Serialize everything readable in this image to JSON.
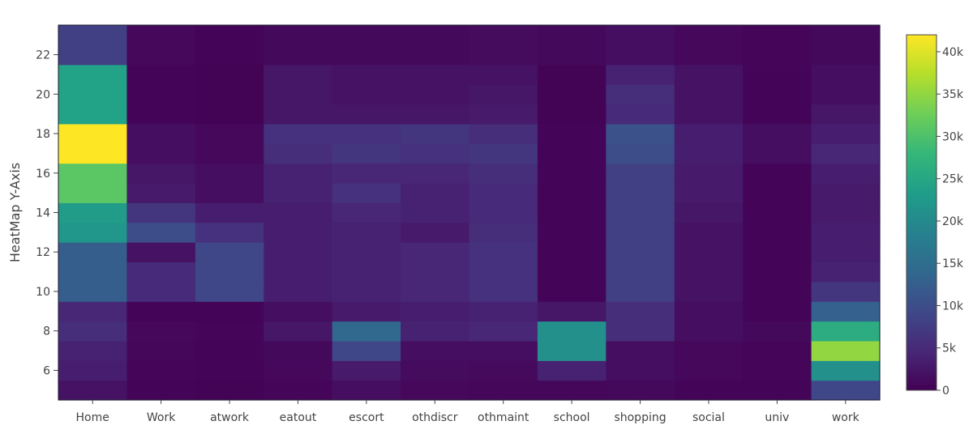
{
  "chart_data": {
    "type": "heatmap",
    "title": "",
    "xlabel": "",
    "ylabel": "HeatMap Y-Axis",
    "categories": [
      "Home",
      "Work",
      "atwork",
      "eatout",
      "escort",
      "othdiscr",
      "othmaint",
      "school",
      "shopping",
      "social",
      "univ",
      "work"
    ],
    "y": [
      5,
      6,
      7,
      8,
      9,
      10,
      11,
      12,
      13,
      14,
      15,
      16,
      17,
      18,
      19,
      20,
      21,
      22,
      23
    ],
    "y_ticks": [
      6,
      8,
      10,
      12,
      14,
      16,
      18,
      20,
      22
    ],
    "colorscale": "viridis",
    "zmin": 0,
    "zmax": 42000,
    "colorbar_ticks": [
      0,
      5000,
      10000,
      15000,
      20000,
      25000,
      30000,
      35000,
      40000
    ],
    "colorbar_tick_labels": [
      "0",
      "5k",
      "10k",
      "15k",
      "20k",
      "25k",
      "30k",
      "35k",
      "40k"
    ],
    "grid": false,
    "z": [
      [
        2000,
        500,
        300,
        600,
        1500,
        800,
        700,
        700,
        1000,
        500,
        500,
        9000
      ],
      [
        3500,
        600,
        400,
        800,
        3000,
        1200,
        1100,
        4000,
        1500,
        800,
        600,
        21000
      ],
      [
        4000,
        700,
        500,
        1000,
        9000,
        1500,
        1500,
        21000,
        1500,
        800,
        600,
        35000
      ],
      [
        5500,
        800,
        600,
        2500,
        14000,
        4000,
        4500,
        21000,
        5500,
        1500,
        900,
        26000
      ],
      [
        4500,
        500,
        400,
        1500,
        3000,
        3500,
        4000,
        2500,
        5500,
        1500,
        500,
        13000
      ],
      [
        12500,
        5000,
        9000,
        3500,
        4000,
        4500,
        6000,
        500,
        8000,
        2000,
        500,
        6500
      ],
      [
        12500,
        5000,
        9000,
        3500,
        4000,
        4500,
        6000,
        500,
        8000,
        2000,
        500,
        4000
      ],
      [
        12500,
        2000,
        9000,
        3500,
        4000,
        4500,
        6000,
        500,
        8000,
        2000,
        500,
        3500
      ],
      [
        22000,
        10000,
        6000,
        3500,
        4000,
        3000,
        5500,
        500,
        8000,
        2000,
        500,
        3500
      ],
      [
        23000,
        6500,
        3500,
        3500,
        4500,
        4000,
        5000,
        500,
        8000,
        2500,
        500,
        3000
      ],
      [
        31000,
        3000,
        1500,
        4000,
        6000,
        4000,
        5000,
        500,
        8000,
        3000,
        500,
        3000
      ],
      [
        31000,
        2500,
        1500,
        4000,
        4500,
        4500,
        5500,
        500,
        8000,
        3000,
        500,
        3500
      ],
      [
        42000,
        1500,
        800,
        5500,
        6500,
        6000,
        6500,
        500,
        10000,
        3500,
        1500,
        4500
      ],
      [
        42000,
        1500,
        800,
        6000,
        6000,
        6500,
        5500,
        500,
        10500,
        3500,
        1500,
        3500
      ],
      [
        24000,
        500,
        300,
        2500,
        2500,
        2500,
        3000,
        300,
        5000,
        2000,
        500,
        2500
      ],
      [
        24000,
        500,
        300,
        2500,
        2000,
        2000,
        2500,
        300,
        5500,
        2000,
        500,
        1500
      ],
      [
        24000,
        500,
        300,
        2500,
        2000,
        2000,
        2000,
        300,
        4000,
        2000,
        500,
        1500
      ],
      [
        8000,
        800,
        500,
        1000,
        1000,
        1000,
        1200,
        1000,
        1500,
        800,
        600,
        1000
      ],
      [
        8000,
        800,
        500,
        1000,
        1000,
        1000,
        1200,
        1000,
        1500,
        800,
        600,
        1000
      ]
    ]
  }
}
